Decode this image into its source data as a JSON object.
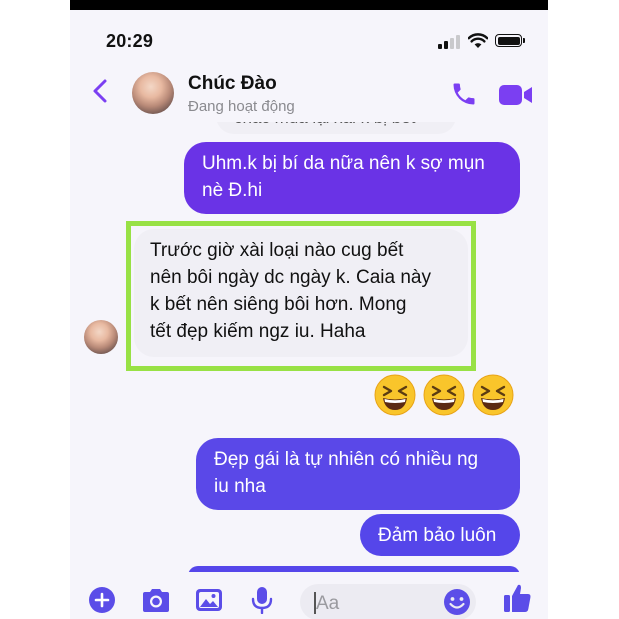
{
  "status_bar": {
    "time": "20:29"
  },
  "header": {
    "contact_name": "Chúc Đào",
    "contact_status": "Đang hoạt động"
  },
  "messages": [
    {
      "direction": "incoming",
      "text": "chắc mùa lại xài k bị bết",
      "cut_off": true
    },
    {
      "direction": "outgoing",
      "lines": [
        "Uhm.k bị bí da nữa nên k sợ mụn",
        "nè Đ.hi"
      ]
    },
    {
      "direction": "incoming",
      "highlighted": true,
      "lines": [
        "Trước giờ xài loại nào cug bết",
        "nên bôi ngày dc ngày k. Caia này",
        "k bết nên siêng bôi hơn. Mong",
        "tết đẹp kiếm ngz iu. Haha"
      ]
    },
    {
      "direction": "outgoing",
      "type": "emoji",
      "emojis": [
        "grinning-squinting-face",
        "grinning-squinting-face",
        "grinning-squinting-face"
      ]
    },
    {
      "direction": "outgoing",
      "lines": [
        "Đẹp gái là tự nhiên có nhiều ng",
        "iu nha"
      ]
    },
    {
      "direction": "outgoing",
      "lines": [
        "Đảm bảo luôn"
      ]
    }
  ],
  "composer": {
    "placeholder": "Aa"
  },
  "colors": {
    "accent": "#7b3ff2",
    "outgoing_bubble": "#6a33e6",
    "incoming_bubble": "#f0eff5",
    "highlight_border": "#98e145"
  },
  "icons": [
    "back-chevron-icon",
    "phone-icon",
    "video-camera-icon",
    "plus-icon",
    "camera-icon",
    "gallery-icon",
    "microphone-icon",
    "emoji-icon",
    "thumbs-up-icon"
  ]
}
